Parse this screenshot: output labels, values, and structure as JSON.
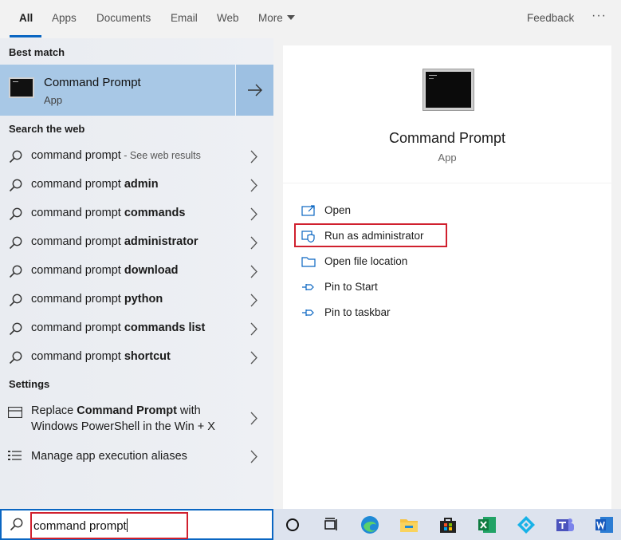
{
  "tabs": [
    "All",
    "Apps",
    "Documents",
    "Email",
    "Web",
    "More"
  ],
  "feedback": "Feedback",
  "more_dots": "···",
  "best_match": {
    "section_title": "Best match",
    "title": "Command Prompt",
    "subtitle": "App"
  },
  "search_web": {
    "section_title": "Search the web",
    "items": [
      {
        "prefix": "command prompt",
        "bold": "",
        "hint": " - See web results"
      },
      {
        "prefix": "command prompt ",
        "bold": "admin",
        "hint": ""
      },
      {
        "prefix": "command prompt ",
        "bold": "commands",
        "hint": ""
      },
      {
        "prefix": "command prompt ",
        "bold": "administrator",
        "hint": ""
      },
      {
        "prefix": "command prompt ",
        "bold": "download",
        "hint": ""
      },
      {
        "prefix": "command prompt ",
        "bold": "python",
        "hint": ""
      },
      {
        "prefix": "command prompt ",
        "bold": "commands list",
        "hint": ""
      },
      {
        "prefix": "command prompt ",
        "bold": "shortcut",
        "hint": ""
      }
    ]
  },
  "settings": {
    "section_title": "Settings",
    "replace": {
      "line1_a": "Replace ",
      "line1_b": "Command Prompt",
      "line1_c": " with",
      "line2": "Windows PowerShell in the Win + X"
    },
    "aliases": "Manage app execution aliases"
  },
  "detail": {
    "title": "Command Prompt",
    "subtitle": "App",
    "actions": [
      {
        "label": "Open",
        "icon": "open-icon"
      },
      {
        "label": "Run as administrator",
        "icon": "shield-icon"
      },
      {
        "label": "Open file location",
        "icon": "folder-icon"
      },
      {
        "label": "Pin to Start",
        "icon": "pin-icon"
      },
      {
        "label": "Pin to taskbar",
        "icon": "pin-icon"
      }
    ]
  },
  "search": {
    "value": "command prompt"
  },
  "taskbar": [
    "cortana-icon",
    "task-view-icon",
    "edge-icon",
    "file-explorer-icon",
    "store-icon",
    "excel-icon",
    "kodi-icon",
    "teams-icon",
    "word-icon"
  ],
  "colors": {
    "accent": "#0a66c2",
    "highlight": "#a8c8e6",
    "redbox": "#d0202e"
  }
}
